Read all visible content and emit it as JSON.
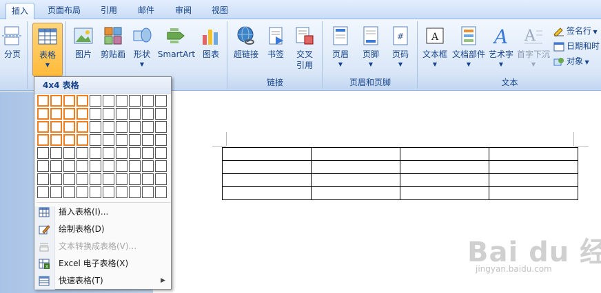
{
  "tabs": [
    {
      "label": "插入",
      "active": true
    },
    {
      "label": "页面布局"
    },
    {
      "label": "引用"
    },
    {
      "label": "邮件"
    },
    {
      "label": "审阅"
    },
    {
      "label": "视图"
    }
  ],
  "ribbon": {
    "page_break": "分页",
    "table": "表格",
    "picture": "图片",
    "clipart": "剪贴画",
    "shapes": "形状",
    "smartart": "SmartArt",
    "chart": "图表",
    "hyperlink": "超链接",
    "bookmark": "书签",
    "crossref_line1": "交叉",
    "crossref_line2": "引用",
    "header": "页眉",
    "footer": "页脚",
    "page_number": "页码",
    "textbox": "文本框",
    "quickparts": "文档部件",
    "wordart": "艺术字",
    "dropcap": "首字下沉",
    "signature": "签名行",
    "datetime": "日期和时",
    "object": "对象",
    "group_links": "链接",
    "group_header_footer": "页眉和页脚",
    "group_text": "文本"
  },
  "dropdown": {
    "title": "4x4 表格",
    "items": [
      {
        "label": "插入表格(I)...",
        "enabled": true
      },
      {
        "label": "绘制表格(D)",
        "enabled": true
      },
      {
        "label": "文本转换成表格(V)...",
        "enabled": false
      },
      {
        "label": "Excel 电子表格(X)",
        "enabled": true
      },
      {
        "label": "快速表格(T)",
        "enabled": true,
        "submenu": true
      }
    ]
  },
  "watermark": {
    "brand": "Bai du 经验",
    "url": "jingyan.baidu.com"
  },
  "colors": {
    "accent": "#15428b",
    "selection": "#f07d1e",
    "active_button": "#ffbb3b"
  }
}
